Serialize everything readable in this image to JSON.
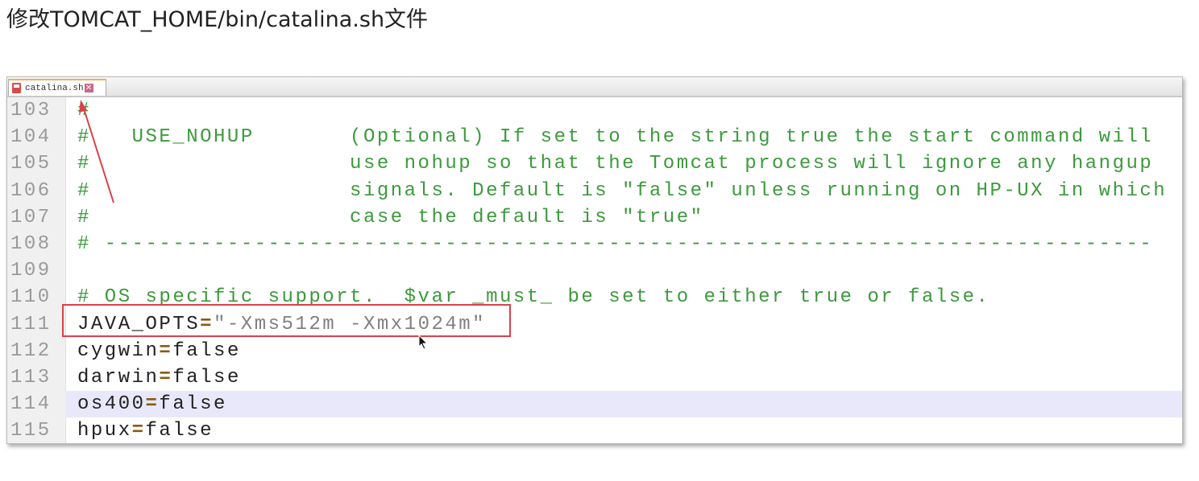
{
  "title": "修改TOMCAT_HOME/bin/catalina.sh文件",
  "editor": {
    "tab": {
      "label": "catalina.sh",
      "close": "✕"
    },
    "highlighted_line": 114,
    "lines": [
      {
        "num": "103",
        "tokens": [
          {
            "t": "#",
            "k": "comment"
          }
        ]
      },
      {
        "num": "104",
        "tokens": [
          {
            "t": "#   USE_NOHUP       (Optional) If set to the string true the start command will",
            "k": "comment"
          }
        ]
      },
      {
        "num": "105",
        "tokens": [
          {
            "t": "#                   use nohup so that the Tomcat process will ignore any hangup",
            "k": "comment"
          }
        ]
      },
      {
        "num": "106",
        "tokens": [
          {
            "t": "#                   signals. Default is \"false\" unless running on HP-UX in which",
            "k": "comment"
          }
        ]
      },
      {
        "num": "107",
        "tokens": [
          {
            "t": "#                   case the default is \"true\"",
            "k": "comment"
          }
        ]
      },
      {
        "num": "108",
        "tokens": [
          {
            "t": "# -----------------------------------------------------------------------------",
            "k": "comment"
          }
        ]
      },
      {
        "num": "109",
        "tokens": []
      },
      {
        "num": "110",
        "tokens": [
          {
            "t": "# OS specific support.  $var _must_ be set to either true or false.",
            "k": "comment"
          }
        ]
      },
      {
        "num": "111",
        "tokens": [
          {
            "t": "JAVA_OPTS",
            "k": "plain"
          },
          {
            "t": "=",
            "k": "op"
          },
          {
            "t": "\"-Xms512m -Xmx1024m\"",
            "k": "str"
          }
        ]
      },
      {
        "num": "112",
        "tokens": [
          {
            "t": "cygwin",
            "k": "plain"
          },
          {
            "t": "=",
            "k": "op"
          },
          {
            "t": "false",
            "k": "plain"
          }
        ]
      },
      {
        "num": "113",
        "tokens": [
          {
            "t": "darwin",
            "k": "plain"
          },
          {
            "t": "=",
            "k": "op"
          },
          {
            "t": "false",
            "k": "plain"
          }
        ]
      },
      {
        "num": "114",
        "tokens": [
          {
            "t": "os400",
            "k": "plain"
          },
          {
            "t": "=",
            "k": "op"
          },
          {
            "t": "false",
            "k": "plain"
          }
        ]
      },
      {
        "num": "115",
        "tokens": [
          {
            "t": "hpux",
            "k": "plain"
          },
          {
            "t": "=",
            "k": "op"
          },
          {
            "t": "false",
            "k": "plain"
          }
        ]
      }
    ]
  },
  "annotation_color": "#d9424a"
}
